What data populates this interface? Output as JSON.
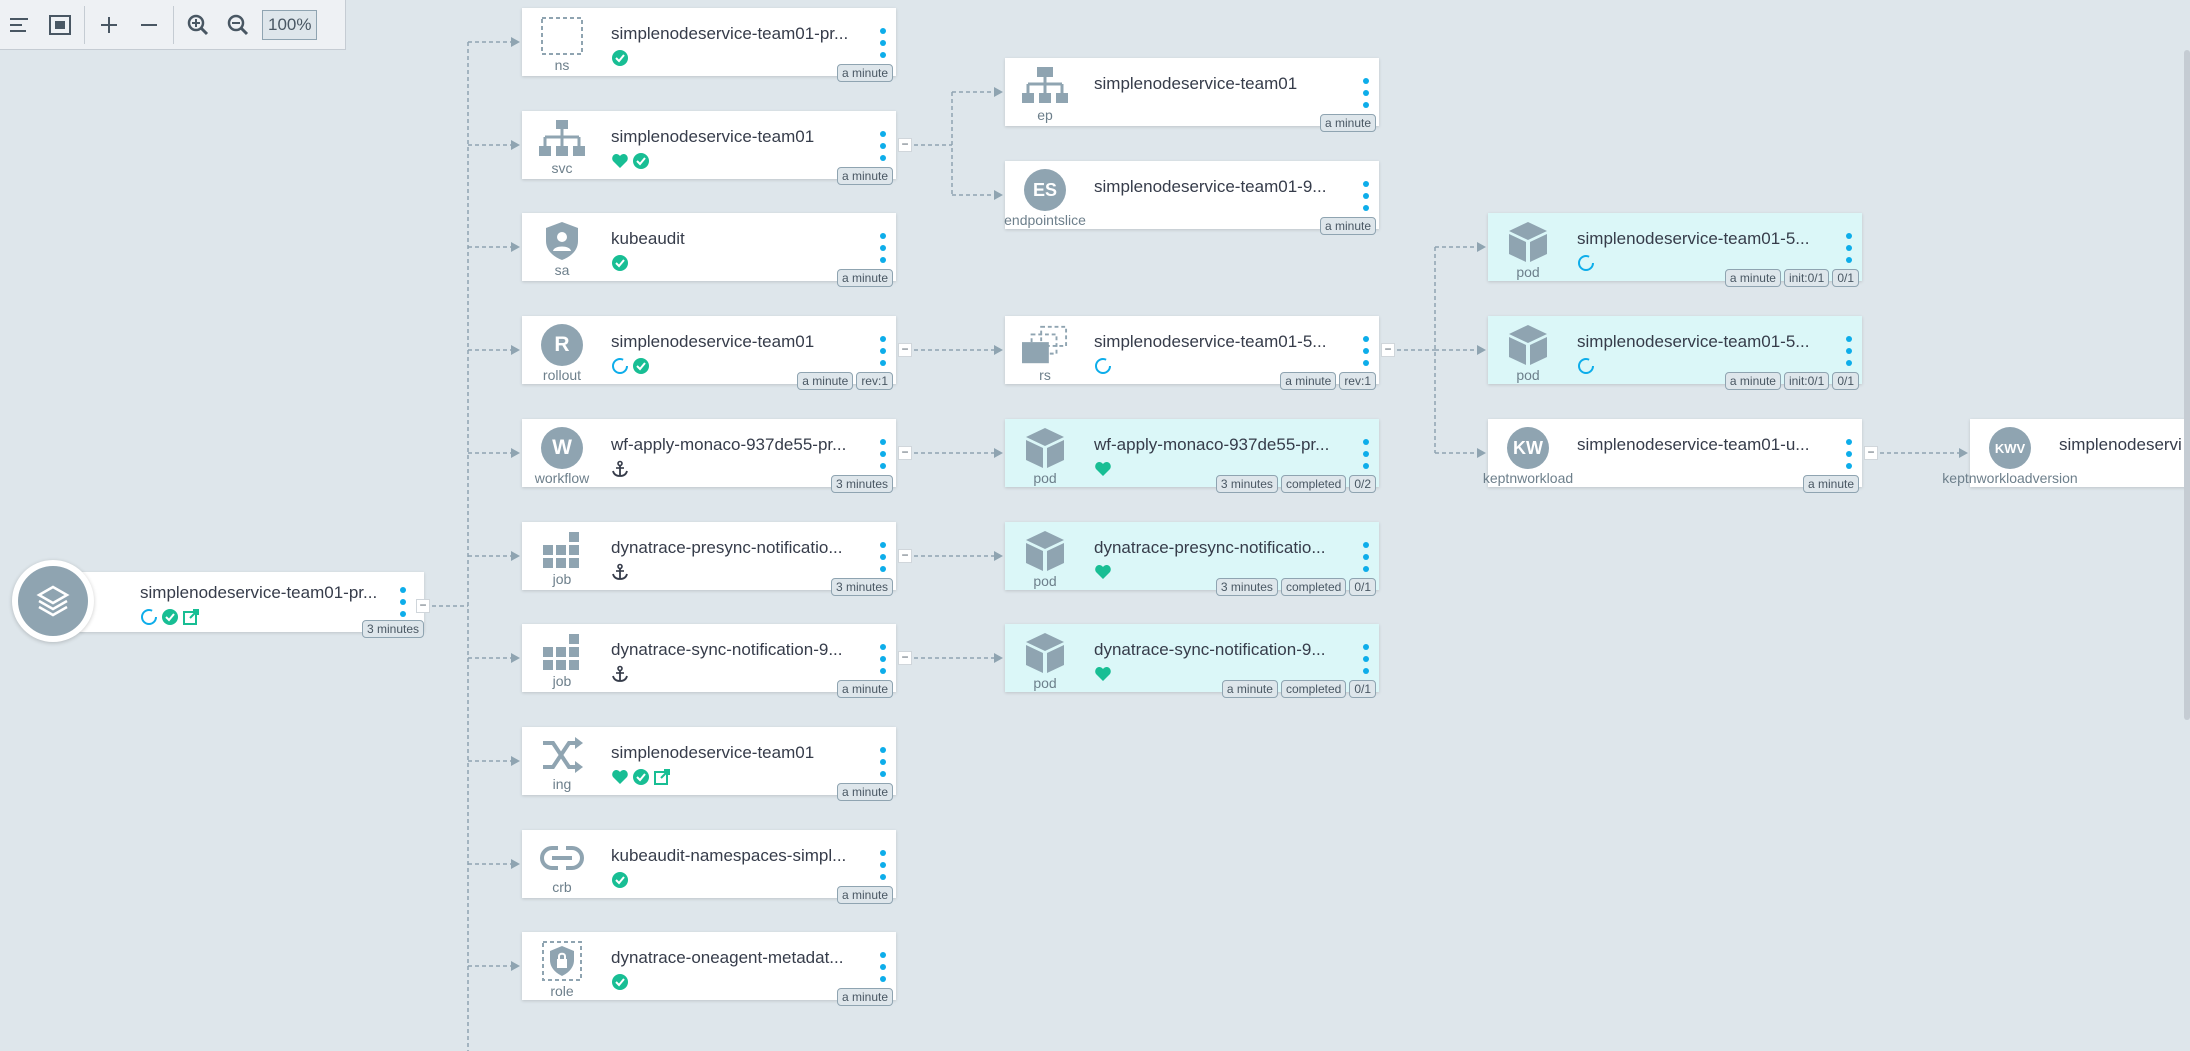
{
  "toolbar": {
    "zoom_label": "100%"
  },
  "root": {
    "name": "simplenodeservice-team01-pr...",
    "age": "3 minutes"
  },
  "nodes": [
    {
      "kind": "ns",
      "name": "simplenodeservice-team01-pr...",
      "tags": [
        "a minute"
      ]
    },
    {
      "kind": "svc",
      "name": "simplenodeservice-team01",
      "tags": [
        "a minute"
      ]
    },
    {
      "kind": "sa",
      "name": "kubeaudit",
      "tags": [
        "a minute"
      ]
    },
    {
      "kind": "rollout",
      "name": "simplenodeservice-team01",
      "tags": [
        "a minute",
        "rev:1"
      ]
    },
    {
      "kind": "workflow",
      "name": "wf-apply-monaco-937de55-pr...",
      "tags": [
        "3 minutes"
      ]
    },
    {
      "kind": "job",
      "name": "dynatrace-presync-notificatio...",
      "tags": [
        "3 minutes"
      ]
    },
    {
      "kind": "job",
      "name": "dynatrace-sync-notification-9...",
      "tags": [
        "a minute"
      ]
    },
    {
      "kind": "ing",
      "name": "simplenodeservice-team01",
      "tags": [
        "a minute"
      ]
    },
    {
      "kind": "crb",
      "name": "kubeaudit-namespaces-simpl...",
      "tags": [
        "a minute"
      ]
    },
    {
      "kind": "role",
      "name": "dynatrace-oneagent-metadat...",
      "tags": [
        "a minute"
      ]
    },
    {
      "kind": "ep",
      "name": "simplenodeservice-team01",
      "tags": [
        "a minute"
      ]
    },
    {
      "kind": "endpointslice",
      "name": "simplenodeservice-team01-9...",
      "tags": [
        "a minute"
      ]
    },
    {
      "kind": "rs",
      "name": "simplenodeservice-team01-5...",
      "tags": [
        "a minute",
        "rev:1"
      ]
    },
    {
      "kind": "pod",
      "name": "wf-apply-monaco-937de55-pr...",
      "tags": [
        "3 minutes",
        "completed",
        "0/2"
      ]
    },
    {
      "kind": "pod",
      "name": "dynatrace-presync-notificatio...",
      "tags": [
        "3 minutes",
        "completed",
        "0/1"
      ]
    },
    {
      "kind": "pod",
      "name": "dynatrace-sync-notification-9...",
      "tags": [
        "a minute",
        "completed",
        "0/1"
      ]
    },
    {
      "kind": "pod",
      "name": "simplenodeservice-team01-5...",
      "tags": [
        "a minute",
        "init:0/1",
        "0/1"
      ]
    },
    {
      "kind": "pod",
      "name": "simplenodeservice-team01-5...",
      "tags": [
        "a minute",
        "init:0/1",
        "0/1"
      ]
    },
    {
      "kind": "keptnworkload",
      "name": "simplenodeservice-team01-u...",
      "tags": [
        "a minute"
      ]
    },
    {
      "kind": "keptnworkloadversion",
      "name": "simplenodeservi",
      "tags": []
    }
  ],
  "icon_letters": {
    "rollout": "R",
    "workflow": "W",
    "endpointslice": "ES",
    "keptnworkload": "KW",
    "keptnworkloadversion": "KWV"
  },
  "colors": {
    "healthy": "#18be94",
    "progressing": "#0dadea",
    "icon": "#8fa4b1",
    "pod_bg": "#dbf7f8"
  }
}
